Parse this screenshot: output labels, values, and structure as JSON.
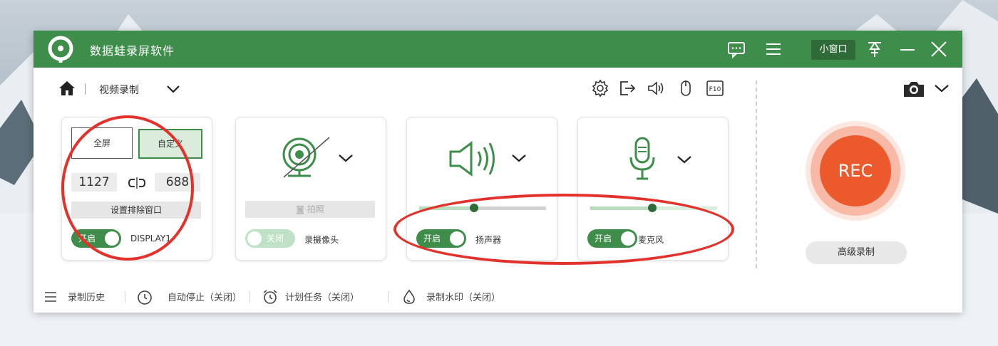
{
  "app": {
    "title": "数据蛙录屏软件"
  },
  "titlebar": {
    "mini_window_label": "小窗口"
  },
  "toolbar": {
    "mode_label": "视频录制"
  },
  "screen_card": {
    "fullscreen_label": "全屏",
    "custom_label": "自定义",
    "width": "1127",
    "height": "688",
    "exclude_window_label": "设置排除窗口",
    "toggle_label": "开启",
    "display_label": "DISPLAY1"
  },
  "camera_card": {
    "photo_label": "拍照",
    "toggle_label": "关闭",
    "label": "录摄像头"
  },
  "speaker_card": {
    "toggle_label": "开启",
    "label": "扬声器",
    "volume": 0.43
  },
  "mic_card": {
    "toggle_label": "开启",
    "label": "麦克风",
    "volume": 0.49
  },
  "record": {
    "rec_label": "REC",
    "advanced_label": "高级录制"
  },
  "footer": {
    "history_label": "录制历史",
    "auto_stop_label": "自动停止（关闭）",
    "schedule_label": "计划任务（关闭）",
    "watermark_label": "录制水印（关闭）"
  },
  "colors": {
    "brand_green": "#3f8d4b",
    "rec_orange": "#ec5a2c",
    "annotation_red": "#e2322b"
  }
}
